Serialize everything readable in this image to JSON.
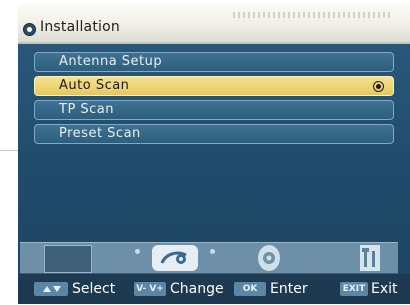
{
  "title": "Installation",
  "menu": {
    "items": [
      {
        "label": "Antenna Setup",
        "selected": false
      },
      {
        "label": "Auto Scan",
        "selected": true
      },
      {
        "label": "TP Scan",
        "selected": false
      },
      {
        "label": "Preset Scan",
        "selected": false
      }
    ]
  },
  "icon_bar": {
    "icons": [
      "tv-icon",
      "satellite-icon",
      "gear-icon",
      "tools-icon"
    ],
    "active": "satellite-icon"
  },
  "footer": {
    "select_label": "Select",
    "change_label": "Change",
    "change_key": "V- V+",
    "enter_label": "Enter",
    "enter_key": "OK",
    "exit_label": "Exit",
    "exit_key": "EXIT"
  }
}
